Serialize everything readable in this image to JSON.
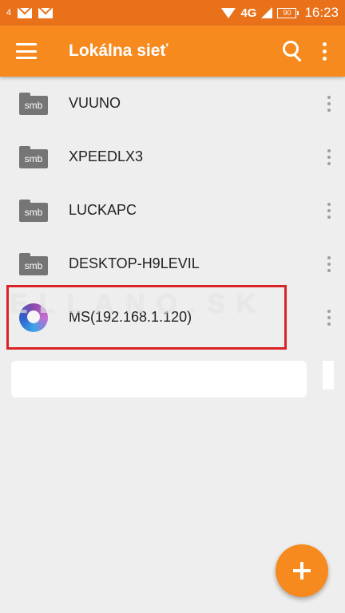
{
  "status_bar": {
    "notification_label": "4",
    "network_type": "4G",
    "battery_level": "90",
    "time": "16:23"
  },
  "app_bar": {
    "title": "Lokálna sieť"
  },
  "list": {
    "items": [
      {
        "label": "VUUNO",
        "icon_text": "smb",
        "icon": "smb-folder-icon"
      },
      {
        "label": "XPEEDLX3",
        "icon_text": "smb",
        "icon": "smb-folder-icon"
      },
      {
        "label": "LUCKAPC",
        "icon_text": "smb",
        "icon": "smb-folder-icon"
      },
      {
        "label": "DESKTOP-H9LEVIL",
        "icon_text": "smb",
        "icon": "smb-folder-icon"
      },
      {
        "label": "MS(192.168.1.120)",
        "icon": "media-server-icon"
      }
    ]
  },
  "watermark": "ELLANO.SK",
  "colors": {
    "status_bar": "#e8711a",
    "app_bar": "#f68a1e",
    "fab": "#f68a1e",
    "highlight": "#d92325"
  }
}
